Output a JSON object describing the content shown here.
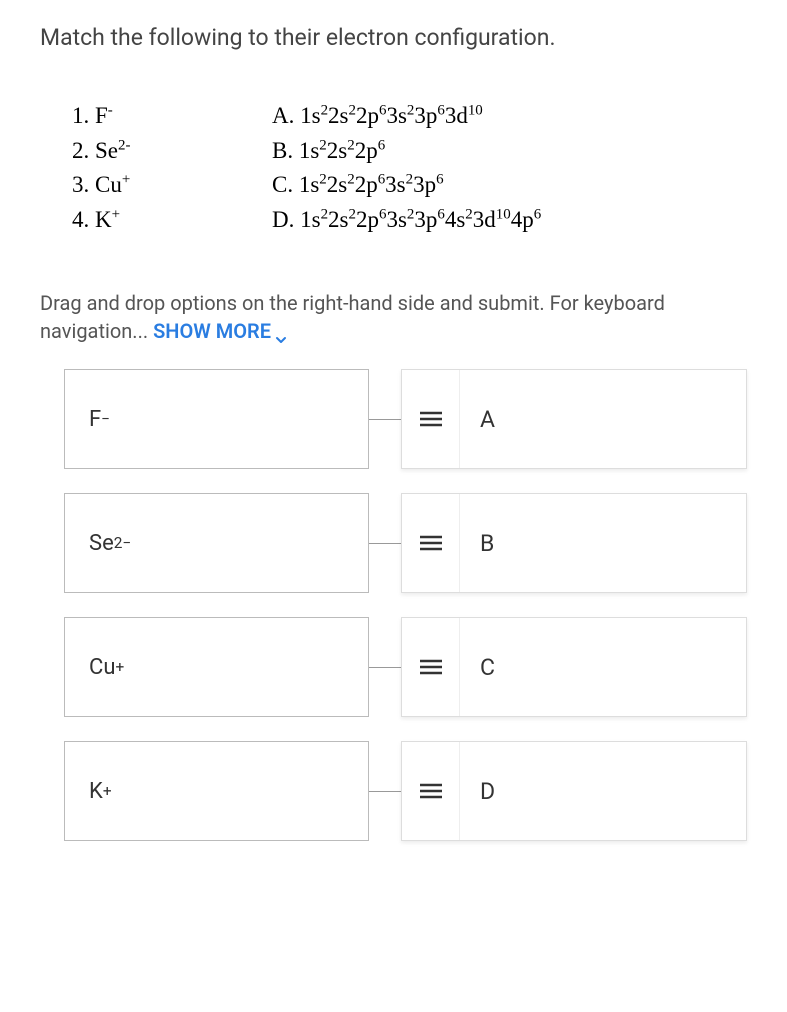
{
  "question": "Match the following to their electron configuration.",
  "reference": {
    "left": [
      {
        "num": "1.",
        "label": "F",
        "sup": "-"
      },
      {
        "num": "2.",
        "label": "Se",
        "sup": "2-"
      },
      {
        "num": "3.",
        "label": "Cu",
        "sup": "+"
      },
      {
        "num": "4.",
        "label": "K",
        "sup": "+"
      }
    ],
    "right": [
      {
        "letter": "A.",
        "config_html": "1s<sup>2</sup>2s<sup>2</sup>2p<sup>6</sup>3s<sup>2</sup>3p<sup>6</sup>3d<sup>10</sup>"
      },
      {
        "letter": "B.",
        "config_html": "1s<sup>2</sup>2s<sup>2</sup>2p<sup>6</sup>"
      },
      {
        "letter": "C.",
        "config_html": "1s<sup>2</sup>2s<sup>2</sup>2p<sup>6</sup>3s<sup>2</sup>3p<sup>6</sup>"
      },
      {
        "letter": "D.",
        "config_html": "1s<sup>2</sup>2s<sup>2</sup>2p<sup>6</sup>3s<sup>2</sup>3p<sup>6</sup>4s<sup>2</sup>3d<sup>10</sup>4p<sup>6</sup>"
      }
    ]
  },
  "instructions_prefix": "Drag and drop options on the right-hand side and submit. For keyboard navigation... ",
  "show_more": "SHOW MORE",
  "matches": [
    {
      "target_html": "F<sup>−</sup>",
      "option": "A"
    },
    {
      "target_html": "Se<sup>2−</sup>",
      "option": "B"
    },
    {
      "target_html": "Cu<sup>+</sup>",
      "option": "C"
    },
    {
      "target_html": "K<sup>+</sup>",
      "option": "D"
    }
  ]
}
